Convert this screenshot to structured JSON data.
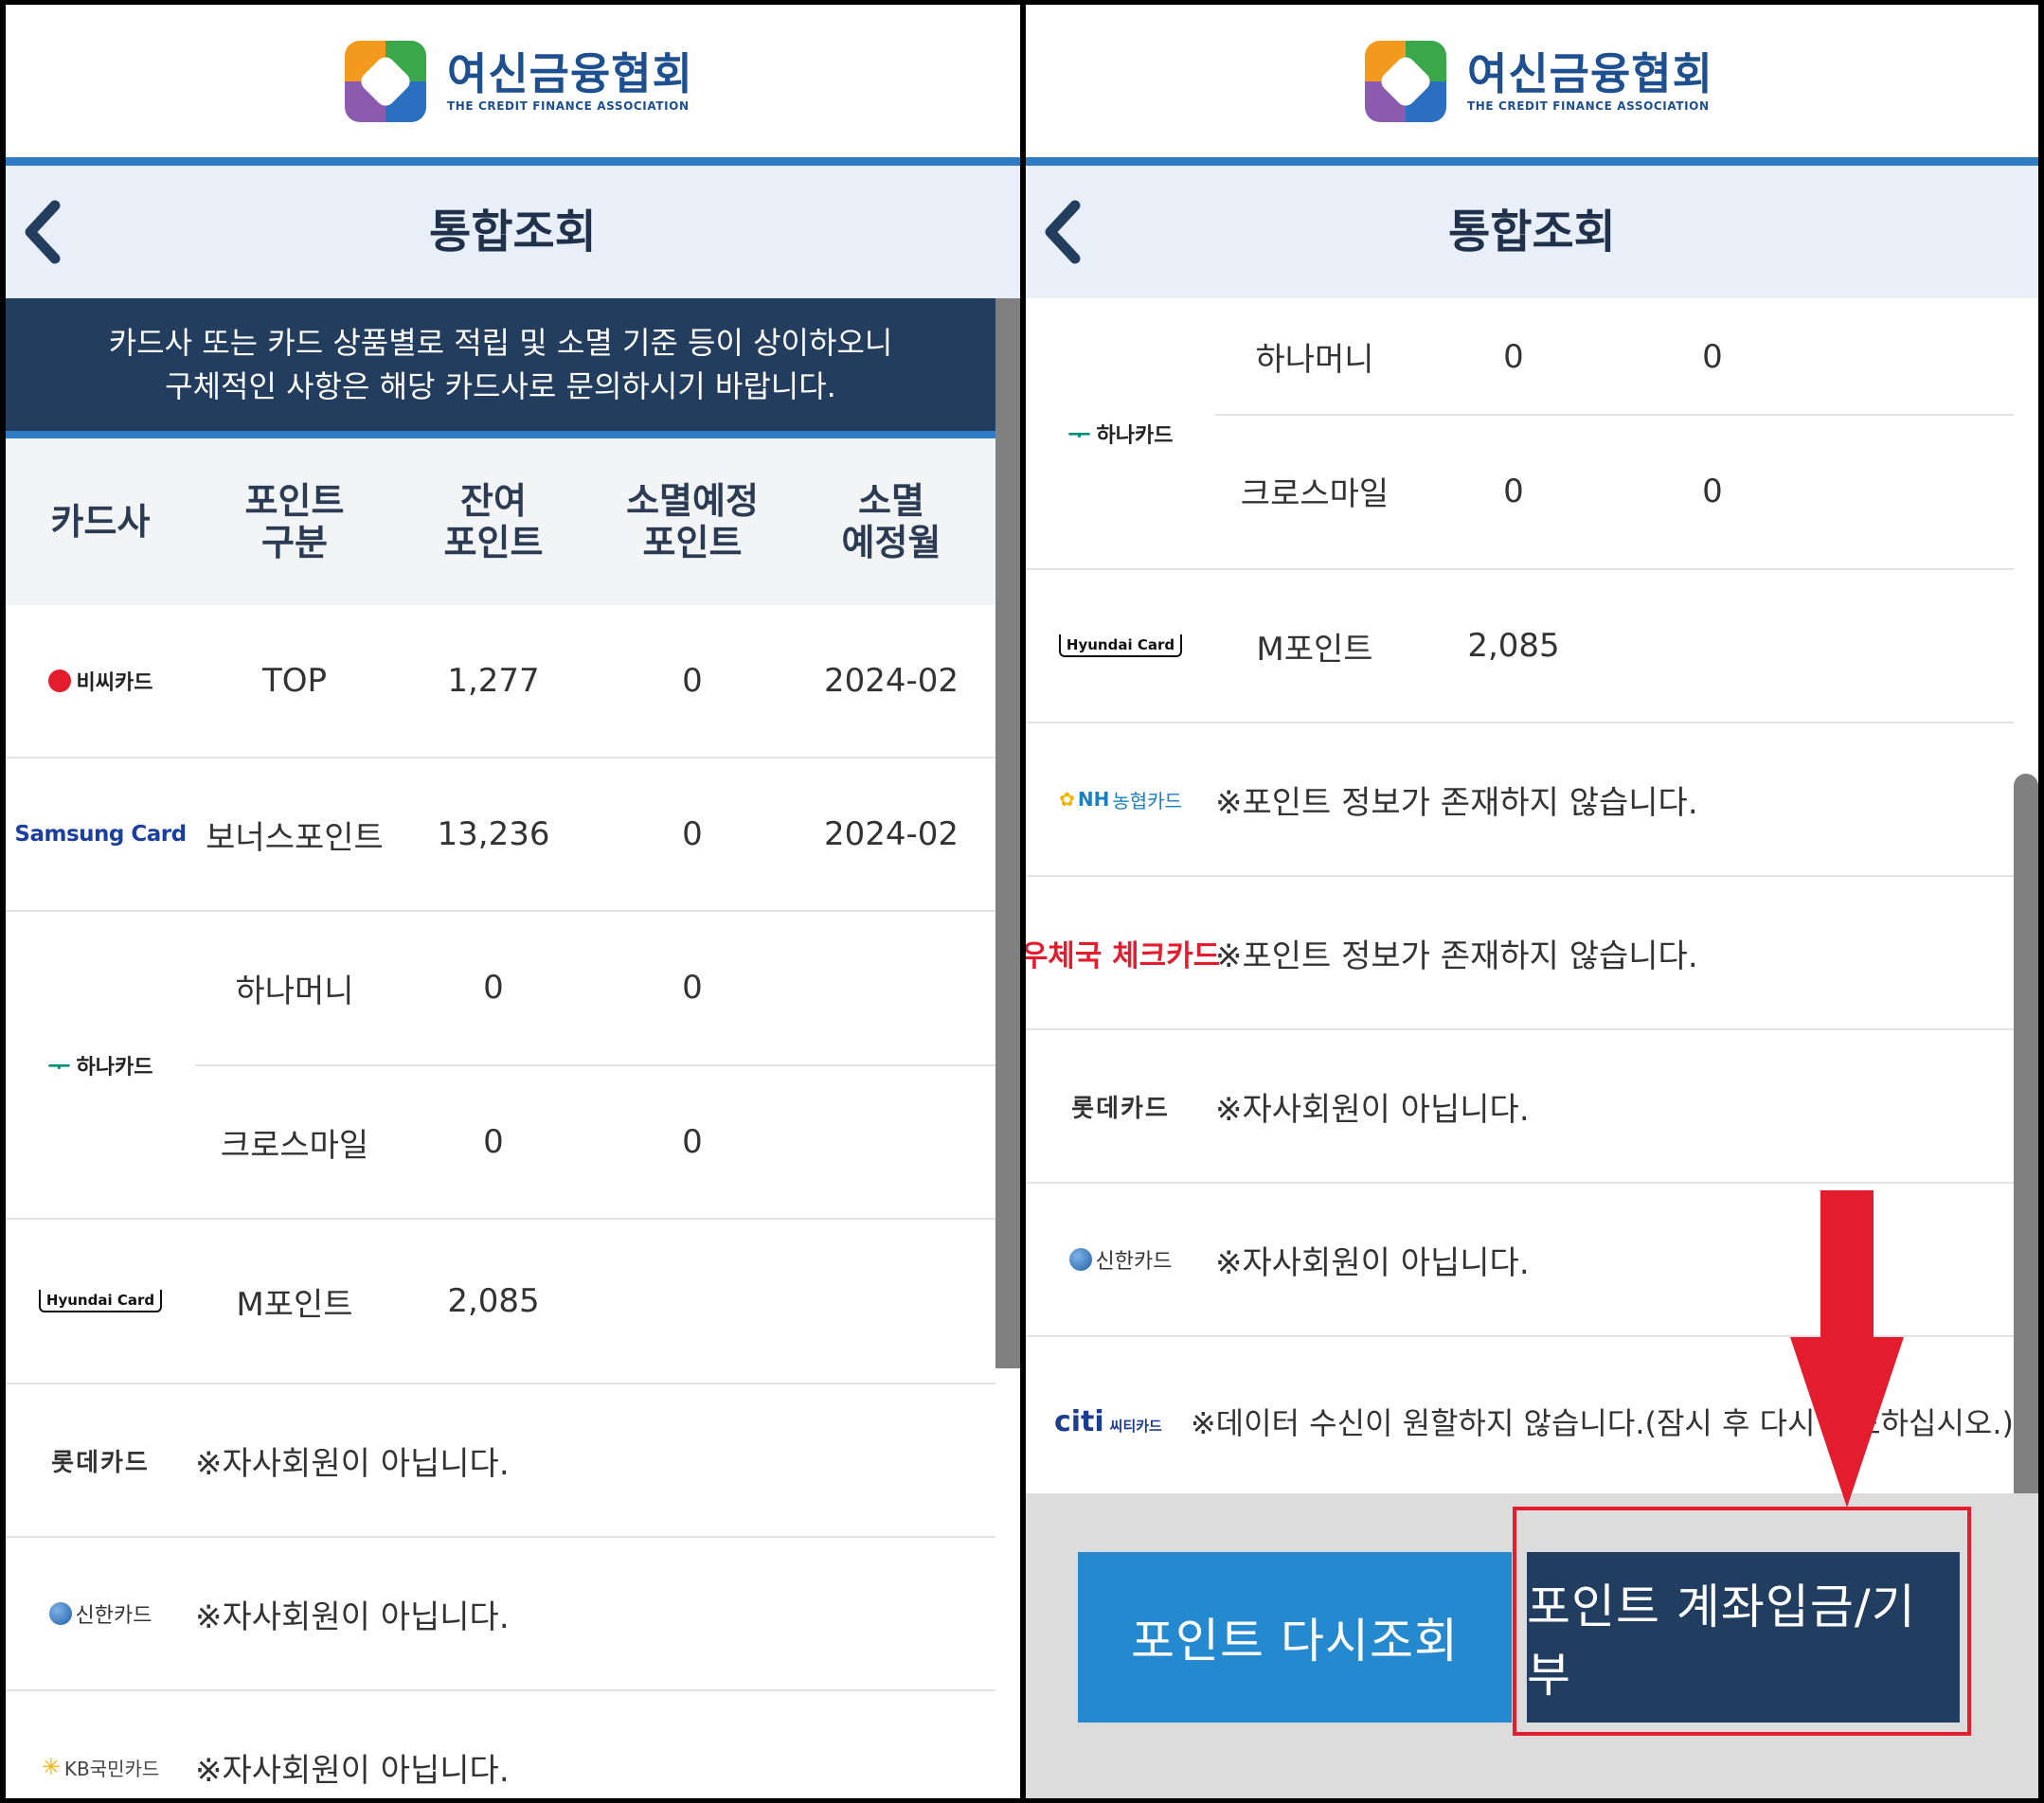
{
  "header": {
    "logo_ko": "여신금융협회",
    "logo_en": "THE CREDIT FINANCE ASSOCIATION",
    "title": "통합조회"
  },
  "notice": {
    "line1": "카드사 또는 카드 상품별로 적립 및 소멸 기준 등이 상이하오니",
    "line2": "구체적인 사항은 해당 카드사로 문의하시기 바랍니다."
  },
  "table": {
    "headers": [
      {
        "line1": "카드사",
        "line2": ""
      },
      {
        "line1": "포인트",
        "line2": "구분"
      },
      {
        "line1": "잔여",
        "line2": "포인트"
      },
      {
        "line1": "소멸예정",
        "line2": "포인트"
      },
      {
        "line1": "소멸",
        "line2": "예정월"
      }
    ]
  },
  "brands": {
    "bc": "비씨카드",
    "samsung": "Samsung Card",
    "hana": "하나카드",
    "hyundai": "Hyundai Card",
    "lotte": "롯데카드",
    "shinhan": "신한카드",
    "kb": "KB국민카드",
    "nh_prefix": "NH",
    "nh_suffix": "농협카드",
    "post": "우체국 체크카드",
    "citi": "citi",
    "citi_sub": "씨티카드"
  },
  "rows": {
    "bc": {
      "type": "TOP",
      "remain": "1,277",
      "expire": "0",
      "month": "2024-02"
    },
    "samsung": {
      "type": "보너스포인트",
      "remain": "13,236",
      "expire": "0",
      "month": "2024-02"
    },
    "hana1": {
      "type": "하나머니",
      "remain": "0",
      "expire": "0"
    },
    "hana2": {
      "type": "크로스마일",
      "remain": "0",
      "expire": "0"
    },
    "hyundai": {
      "type": "M포인트",
      "remain": "2,085"
    }
  },
  "messages": {
    "not_member": "※자사회원이 아닙니다.",
    "no_info": "※포인트 정보가 존재하지 않습니다.",
    "data_error": "※데이터 수신이 원할하지 않습니다.(잠시 후 다시 시도하십시오.)"
  },
  "buttons": {
    "refresh": "포인트 다시조회",
    "deposit": "포인트 계좌입금/기부"
  },
  "colors": {
    "navy": "#233d5e",
    "accent_blue": "#2f7bc4",
    "button_blue": "#2589d0",
    "button_navy": "#213d5f",
    "highlight_red": "#e31d2d"
  }
}
